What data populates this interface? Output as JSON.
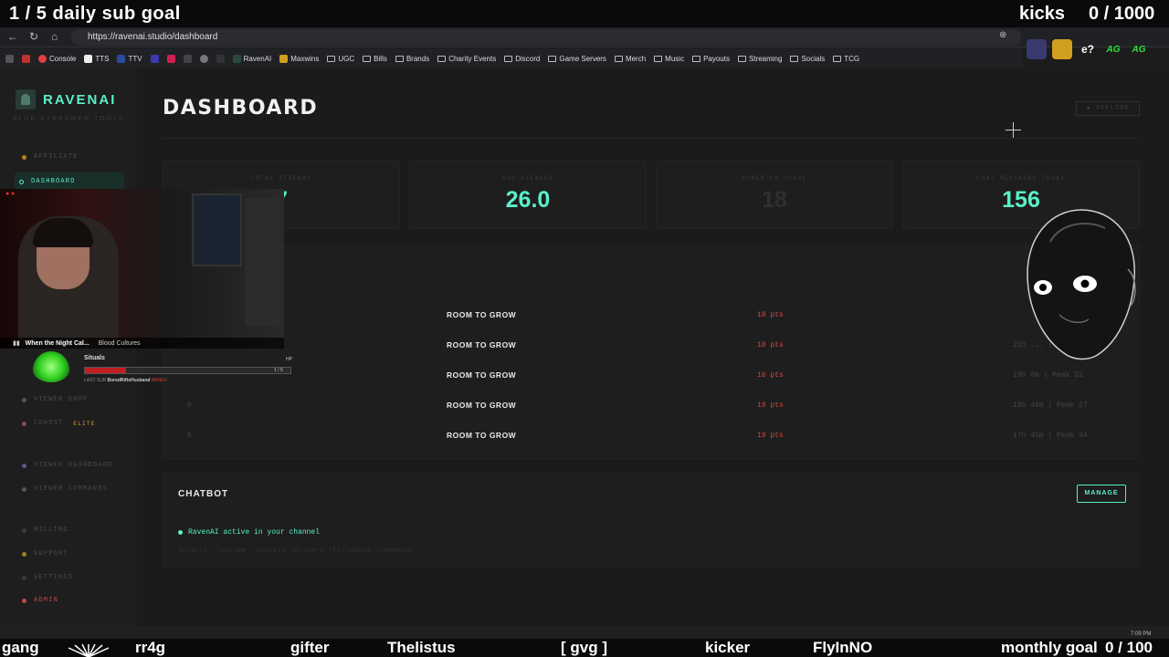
{
  "overlay_top": {
    "goal": "1 / 5   daily sub goal",
    "kicks_label": "kicks",
    "kicks_count": "0 / 1000"
  },
  "browser": {
    "url": "https://ravenai.studio/dashboard"
  },
  "bookmarks": [
    "Console",
    "TTS",
    "TTV",
    "RavenAI",
    "Maxwins",
    "UGC",
    "Bills",
    "Brands",
    "Charity Events",
    "Discord",
    "Game Servers",
    "Merch",
    "Music",
    "Payouts",
    "Streaming",
    "Socials",
    "TCG"
  ],
  "extensions": {
    "e_label": "e?"
  },
  "sidebar": {
    "brand": "RAVENAI",
    "tagline": "BLUE STREAMER TOOLS",
    "items": {
      "affiliate": "AFFILIATE",
      "dashboard": "DASHBOARD",
      "viewer_shop": "VIEWER SHOP",
      "cohost": "COHOST",
      "elite_badge": "ELITE",
      "viewer_dashboard": "VIEWER DASHBOARD",
      "viewer_commands": "VIEWER COMMANDS",
      "billing": "BILLING",
      "support": "SUPPORT",
      "settings": "SETTINGS",
      "admin": "ADMIN"
    }
  },
  "main": {
    "title": "DASHBOARD",
    "status": "● OFFLINE",
    "stats": [
      {
        "label": "TOTAL STREAMS",
        "value": "7"
      },
      {
        "label": "AVG VIEWERS",
        "value": "26.0"
      },
      {
        "label": "MOMENTUM SCORE",
        "value": "18"
      },
      {
        "label": "CHAT MESSAGES TODAY",
        "value": "156"
      }
    ],
    "rows": [
      {
        "num": "",
        "status": "ROOM TO GROW",
        "pts": "18 pts",
        "dur": ""
      },
      {
        "num": "",
        "status": "ROOM TO GROW",
        "pts": "18 pts",
        "dur": "21h ... | Peak 15"
      },
      {
        "num": "",
        "status": "ROOM TO GROW",
        "pts": "16 pts",
        "dur": "19h 6m  |  Peak 22"
      },
      {
        "num": "0",
        "status": "ROOM TO GROW",
        "pts": "19 pts",
        "dur": "18h 46m  |  Peak 27"
      },
      {
        "num": "0",
        "status": "ROOM TO GROW",
        "pts": "19 pts",
        "dur": "17h 45m  |  Peak 34"
      }
    ],
    "chatbot": {
      "title": "CHATBOT",
      "manage": "MANAGE",
      "active": "RavenAI active in your channel",
      "commands": "Default: !uptime  !socials  !discord  !followage  !commands"
    }
  },
  "webcam": {
    "song_title": "When the Night Cal...",
    "song_artist": "Blood Cultures"
  },
  "sub_overlay": {
    "username": "Situals",
    "hp_label": "HP",
    "hp_value": "1 / 5",
    "last_sub_label": "LAST SUB",
    "last_sub_name": "BoredRiftsHusband",
    "last_sub_extra": "ANNEX"
  },
  "taskbar": {
    "clock": "7:09 PM"
  },
  "ticker": {
    "gang": "gang",
    "rr4g": "rr4g",
    "gifter": "gifter",
    "thelistus": "Thelistus",
    "gvg": "[ gvg ]",
    "kicker": "kicker",
    "flyinno": "FlyInNO",
    "monthly": "monthly goal",
    "monthly_count": "0 / 100"
  },
  "colors": {
    "accent": "#5af0c8",
    "danger": "#d04848",
    "background": "#1b1b1b"
  }
}
